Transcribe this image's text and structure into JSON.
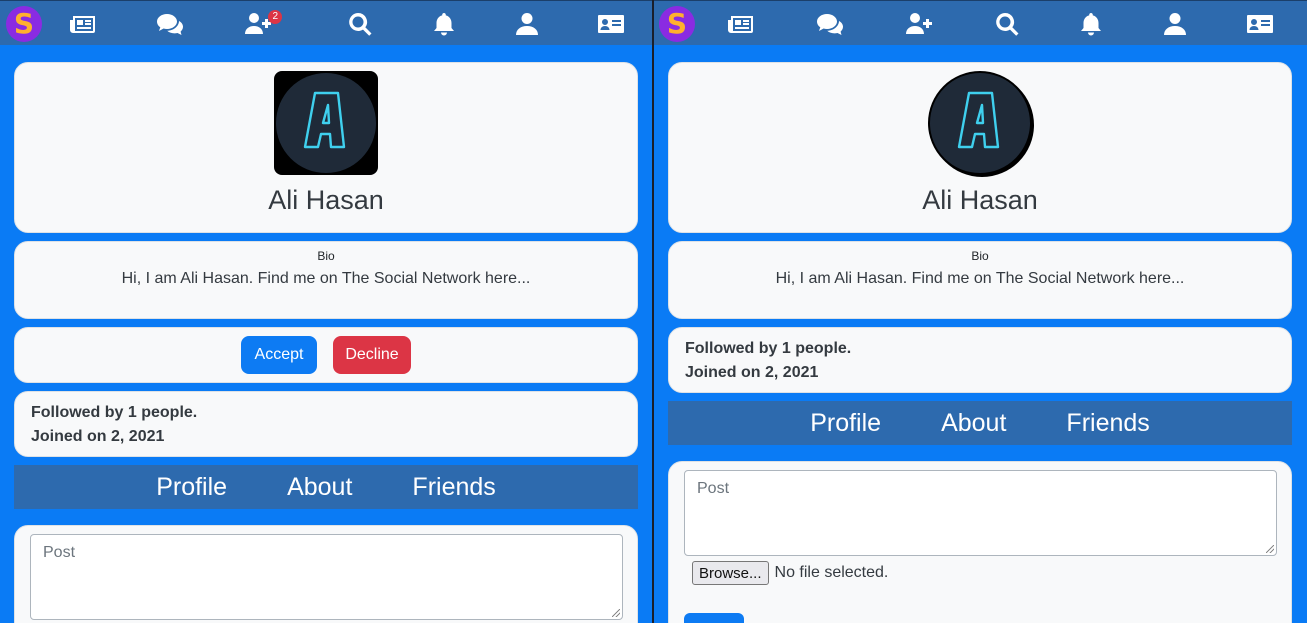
{
  "nav": {
    "friend_request_badge": "2",
    "icons": [
      "logo-s",
      "newspaper-icon",
      "chat-icon",
      "add-user-icon",
      "search-icon",
      "bell-icon",
      "user-icon",
      "id-card-icon"
    ]
  },
  "left": {
    "profile": {
      "name": "Ali Hasan",
      "avatar_letter": "A"
    },
    "bio": {
      "label": "Bio",
      "text": "Hi, I am Ali Hasan. Find me on The Social Network here..."
    },
    "request": {
      "accept_label": "Accept",
      "decline_label": "Decline"
    },
    "stats": {
      "followed": "Followed by 1 people.",
      "joined": "Joined on 2, 2021"
    },
    "tabs": [
      "Profile",
      "About",
      "Friends"
    ],
    "post": {
      "placeholder": "Post"
    }
  },
  "right": {
    "profile": {
      "name": "Ali Hasan",
      "avatar_letter": "A"
    },
    "bio": {
      "label": "Bio",
      "text": "Hi, I am Ali Hasan. Find me on The Social Network here..."
    },
    "stats": {
      "followed": "Followed by 1 people.",
      "joined": "Joined on 2, 2021"
    },
    "tabs": [
      "Profile",
      "About",
      "Friends"
    ],
    "post": {
      "placeholder": "Post",
      "browse_label": "Browse...",
      "file_status": "No file selected."
    }
  },
  "colors": {
    "background": "#0a7bf5",
    "navbar": "#2d6aae",
    "accept": "#0d7bf3",
    "decline": "#dc3545",
    "logo_bg": "#8a2be2",
    "logo_fg": "#ffb02e"
  }
}
